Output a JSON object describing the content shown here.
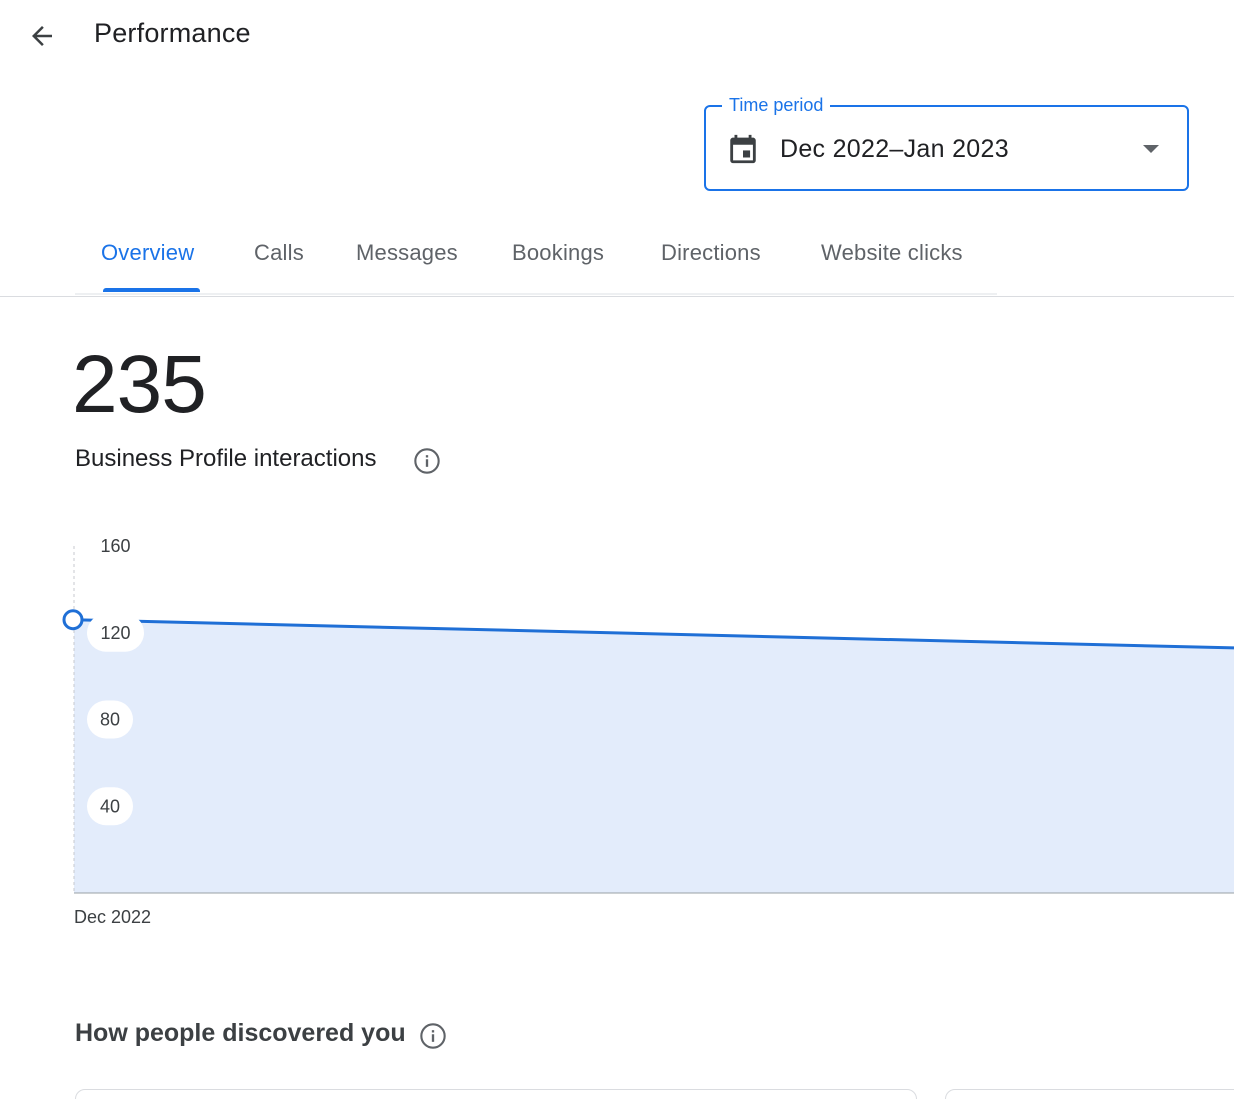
{
  "header": {
    "title": "Performance",
    "back_icon": "arrow-back-icon"
  },
  "time_period": {
    "label": "Time period",
    "value": "Dec 2022–Jan 2023",
    "icon": "calendar-icon"
  },
  "tabs": [
    {
      "label": "Overview",
      "active": true
    },
    {
      "label": "Calls",
      "active": false
    },
    {
      "label": "Messages",
      "active": false
    },
    {
      "label": "Bookings",
      "active": false
    },
    {
      "label": "Directions",
      "active": false
    },
    {
      "label": "Website clicks",
      "active": false
    }
  ],
  "metric": {
    "value": "235",
    "label": "Business Profile interactions"
  },
  "colors": {
    "accent": "#1a73e8",
    "area_fill": "#e3ecfb",
    "line": "#1f6fd6"
  },
  "chart_data": {
    "type": "area",
    "x": [
      "Dec 2022"
    ],
    "x_tick_labels": [
      "Dec 2022"
    ],
    "y_ticks": [
      40,
      80,
      120,
      160
    ],
    "ylim": [
      0,
      160
    ],
    "series": [
      {
        "values": [
          126,
          113
        ]
      }
    ],
    "marker_index": 0,
    "grid": false
  },
  "discovered": {
    "title": "How people discovered you"
  }
}
